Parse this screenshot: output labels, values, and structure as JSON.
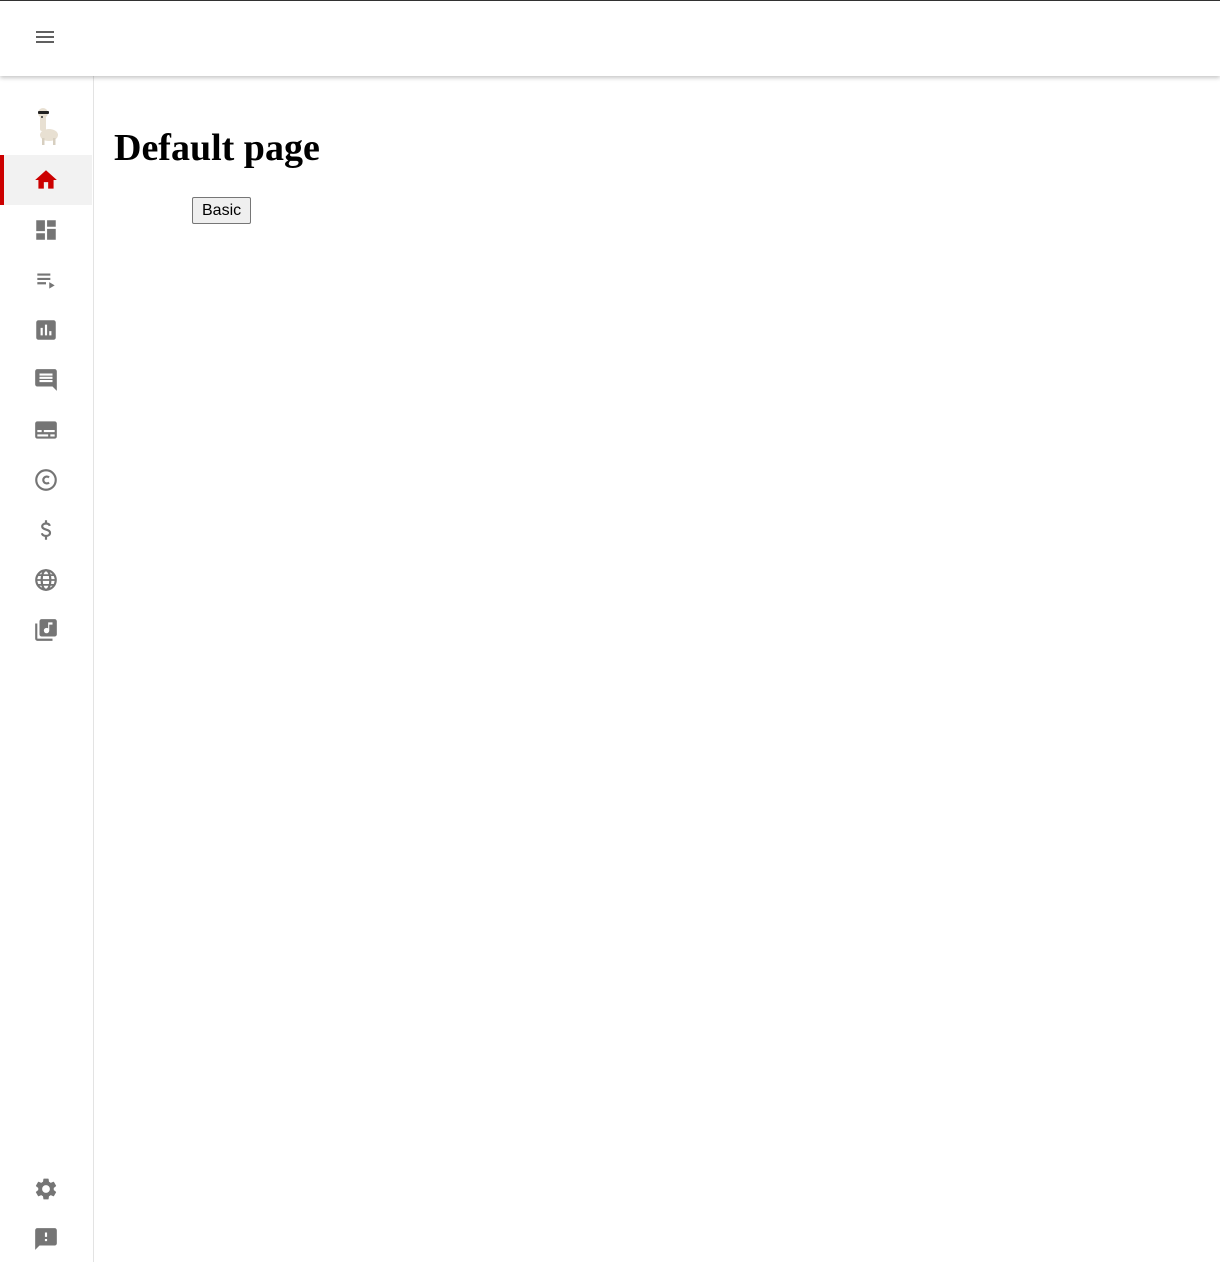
{
  "header": {
    "menu_icon": "menu-icon"
  },
  "sidebar": {
    "logo_icon": "alpaca-logo-icon",
    "accent_color": "#cc0000",
    "icon_color": "#757575",
    "items": [
      {
        "icon": "home-icon",
        "active": true
      },
      {
        "icon": "dashboard-icon",
        "active": false
      },
      {
        "icon": "playlist-play-icon",
        "active": false
      },
      {
        "icon": "bar-chart-icon",
        "active": false
      },
      {
        "icon": "comment-icon",
        "active": false
      },
      {
        "icon": "subtitles-icon",
        "active": false
      },
      {
        "icon": "copyright-icon",
        "active": false
      },
      {
        "icon": "dollar-icon",
        "active": false
      },
      {
        "icon": "globe-icon",
        "active": false
      },
      {
        "icon": "music-library-icon",
        "active": false
      }
    ],
    "bottom_items": [
      {
        "icon": "settings-gear-icon"
      },
      {
        "icon": "feedback-icon"
      }
    ]
  },
  "main": {
    "title": "Default page",
    "button_label": "Basic"
  }
}
